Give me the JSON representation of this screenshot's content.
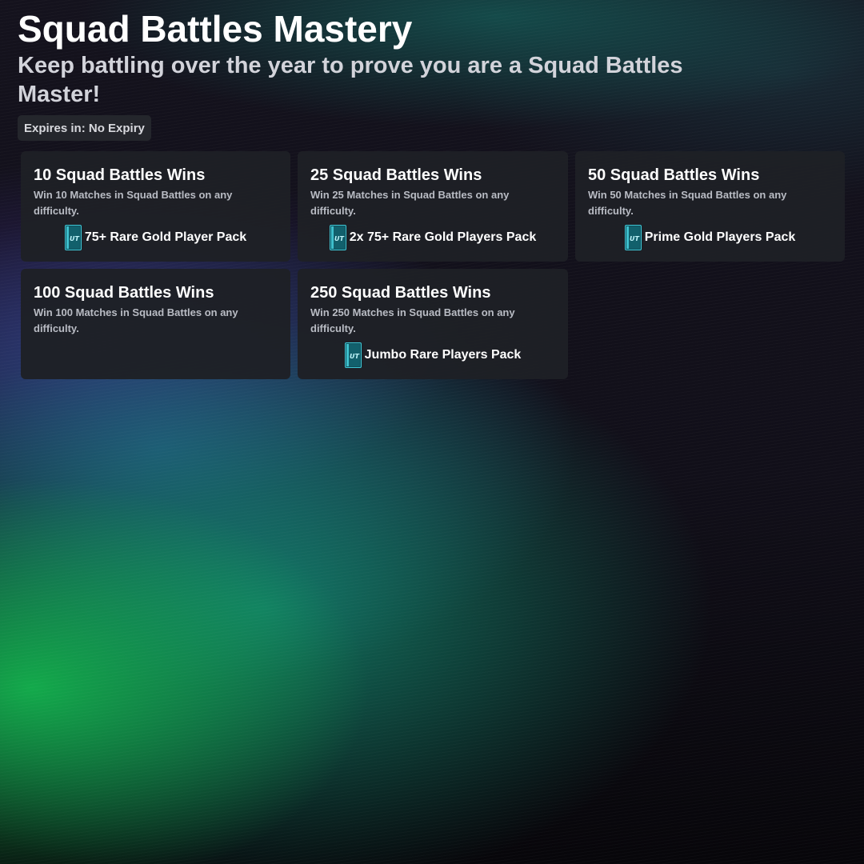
{
  "header": {
    "title": "Squad Battles Mastery",
    "subtitle": "Keep battling over the year to prove you are a Squad Battles Master!",
    "expiry": "Expires in: No Expiry"
  },
  "colors": {
    "card_background": "#1e2025",
    "pack_accent": "#3fc7d6",
    "title_text": "#ffffff",
    "subtitle_text": "#d2d3da"
  },
  "objectives": [
    {
      "title": "10 Squad Battles Wins",
      "description": "Win 10 Matches in Squad Battles on any difficulty.",
      "reward": "75+ Rare Gold Player Pack",
      "reward_icon": "ut-pack-icon"
    },
    {
      "title": "25 Squad Battles Wins",
      "description": "Win 25 Matches in Squad Battles on any difficulty.",
      "reward": "2x 75+ Rare Gold Players Pack",
      "reward_icon": "ut-pack-icon"
    },
    {
      "title": "50 Squad Battles Wins",
      "description": "Win 50 Matches in Squad Battles on any difficulty.",
      "reward": "Prime Gold Players Pack",
      "reward_icon": "ut-pack-icon"
    },
    {
      "title": "100 Squad Battles Wins",
      "description": "Win 100 Matches in Squad Battles on any difficulty."
    },
    {
      "title": "250 Squad Battles Wins",
      "description": "Win 250 Matches in Squad Battles on any difficulty.",
      "reward": "Jumbo Rare Players Pack",
      "reward_icon": "ut-pack-icon"
    }
  ]
}
